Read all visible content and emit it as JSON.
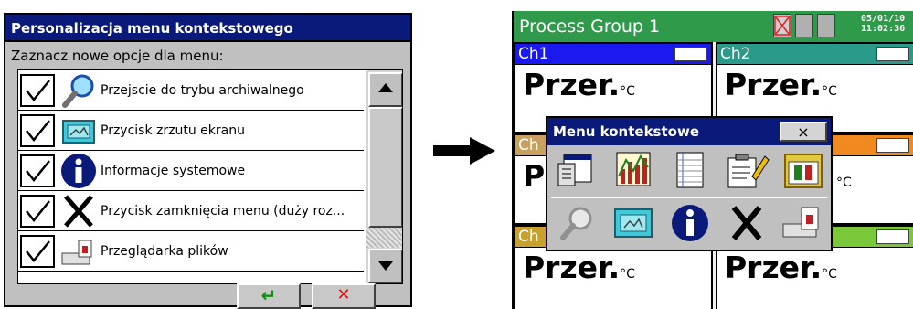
{
  "left_dialog": {
    "title": "Personalizacja menu kontekstowego",
    "subtitle": "Zaznacz nowe opcje dla menu:",
    "options": [
      {
        "label": "Przejscie do trybu archiwalnego",
        "icon": "magnifier-icon",
        "checked": true
      },
      {
        "label": "Przycisk zrzutu ekranu",
        "icon": "screenshot-icon",
        "checked": true
      },
      {
        "label": "Informacje systemowe",
        "icon": "info-icon",
        "checked": true
      },
      {
        "label": "Przycisk zamknięcia menu (duży roz...",
        "icon": "close-x-icon",
        "checked": true
      },
      {
        "label": "Przeglądarka plików",
        "icon": "file-browser-icon",
        "checked": true
      }
    ],
    "ok_symbol": "↵",
    "cancel_symbol": "✕"
  },
  "right_screen": {
    "title": "Process Group 1",
    "date": "05/01/10",
    "time": "11:02:36",
    "channels": [
      {
        "name": "Ch1",
        "value": "Przer.",
        "unit": "°C",
        "color": "#1a1af0"
      },
      {
        "name": "Ch2",
        "value": "Przer.",
        "unit": "°C",
        "color": "#2a9a8a"
      },
      {
        "name": "Ch",
        "value": "P",
        "unit": "",
        "color": "#c8a060"
      },
      {
        "name": "",
        "value": "",
        "unit": "°C",
        "color": "#f08a20"
      },
      {
        "name": "Ch",
        "value": "Przer.",
        "unit": "°C",
        "color": "#c8a030"
      },
      {
        "name": "",
        "value": "Przer.",
        "unit": "°C",
        "color": "#7ac83a"
      }
    ]
  },
  "context_menu": {
    "title": "Menu kontekstowe",
    "close_symbol": "×"
  },
  "colors": {
    "titlebar": "#0a1a7a",
    "group_bar": "#2f9a4a",
    "dialog_bg": "#c0c0c0"
  }
}
